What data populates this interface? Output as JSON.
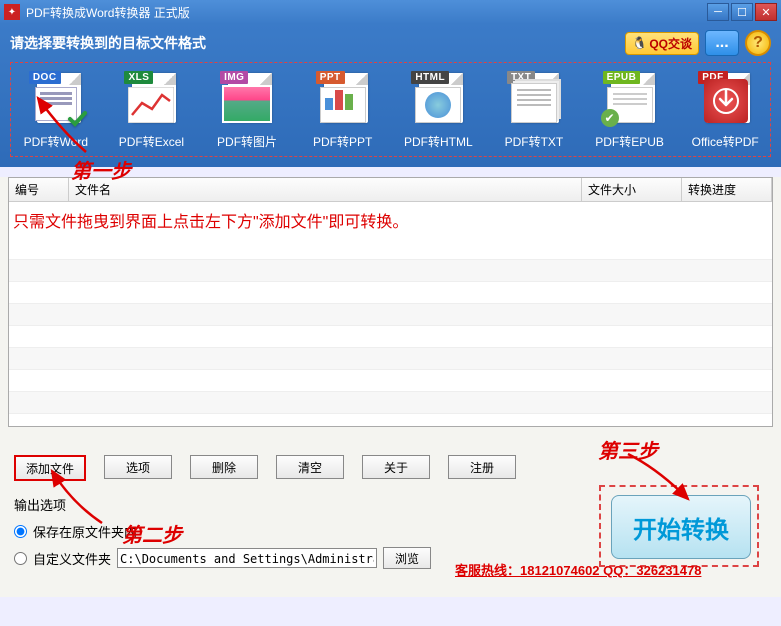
{
  "window": {
    "title": "PDF转换成Word转换器 正式版"
  },
  "header": {
    "label": "请选择要转换到的目标文件格式",
    "qq_label": "QQ交谈",
    "chat_dots": "...",
    "help": "?"
  },
  "formats": [
    {
      "tag": "DOC",
      "tag_color": "#2b6dd1",
      "label": "PDF转Word",
      "icon": "doc",
      "selected": true
    },
    {
      "tag": "XLS",
      "tag_color": "#1e8a3c",
      "label": "PDF转Excel",
      "icon": "xls"
    },
    {
      "tag": "IMG",
      "tag_color": "#b34aa5",
      "label": "PDF转图片",
      "icon": "img"
    },
    {
      "tag": "PPT",
      "tag_color": "#d65a2f",
      "label": "PDF转PPT",
      "icon": "ppt"
    },
    {
      "tag": "HTML",
      "tag_color": "#444",
      "label": "PDF转HTML",
      "icon": "html"
    },
    {
      "tag": "TXT",
      "tag_color": "#888",
      "label": "PDF转TXT",
      "icon": "txt"
    },
    {
      "tag": "EPUB",
      "tag_color": "#6fb71f",
      "label": "PDF转EPUB",
      "icon": "epub"
    },
    {
      "tag": "PDF",
      "tag_color": "#c32020",
      "label": "Office转PDF",
      "icon": "pdf"
    }
  ],
  "table": {
    "headers": {
      "num": "编号",
      "name": "文件名",
      "size": "文件大小",
      "progress": "转换进度"
    },
    "hint": "只需文件拖曳到界面上点击左下方\"添加文件\"即可转换。"
  },
  "buttons": {
    "add": "添加文件",
    "options": "选项",
    "delete": "删除",
    "clear": "清空",
    "about": "关于",
    "register": "注册"
  },
  "output": {
    "title": "输出选项",
    "save_original": "保存在原文件夹内",
    "custom_folder": "自定义文件夹",
    "path": "C:\\Documents and Settings\\Administrator\\桌面",
    "browse": "浏览"
  },
  "start": "开始转换",
  "hotline": "客服热线：18121074602 QQ：326231478",
  "annotations": {
    "step1": "第一步",
    "step2": "第二步",
    "step3": "第三步"
  }
}
